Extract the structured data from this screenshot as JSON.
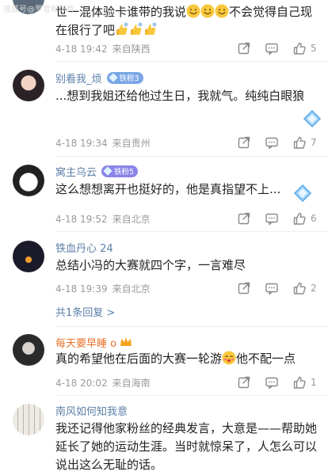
{
  "watermark": "搜狐号@罗雪和体育",
  "comments": [
    {
      "text_pre": "世一混体验卡谁带的我说",
      "text_post": "不会觉得自己现在很行了吧",
      "date": "4-18 19:42",
      "location": "来自陕西",
      "likes": "5"
    },
    {
      "username": "别看我_烦",
      "badge": "铁粉3",
      "text": "...想到我姐还给他过生日，我就气。纯纯白眼狼",
      "date": "4-18 19:34",
      "location": "来自贵州",
      "likes": "7"
    },
    {
      "username": "窝主乌云",
      "badge": "铁粉5",
      "text": "这么想想离开也挺好的，他是真指望不上...",
      "date": "4-18 19:52",
      "location": "来自北京",
      "likes": "6"
    },
    {
      "username": "铁血丹心 24",
      "text": "总结小冯的大赛就四个字，一言难尽",
      "date": "4-18 19:39",
      "location": "来自北京",
      "likes": "2",
      "replies": "共1条回复 >"
    },
    {
      "username": "每天要早睡 o",
      "text_pre": "真的希望他在后面的大赛一轮游",
      "text_post": "他不配一点",
      "date": "4-18 20:02",
      "location": "来自海南",
      "likes": "1"
    },
    {
      "username": "南风如何知我意",
      "text": "我还记得他家粉丝的经典发言，大意是——帮助她延长了她的运动生涯。当时就惊呆了，人怎么可以说出这么无耻的话。"
    }
  ],
  "icons": [
    "share-icon",
    "comment-icon",
    "like-icon",
    "smile-emoji",
    "thumbs-emoji",
    "blush-emoji",
    "diamond-sticker"
  ],
  "colors": {
    "username": "#5b7fa8",
    "username_highlight": "#e8722c",
    "badge_blue": "#7aa6e6",
    "badge_purple": "#8a84e8",
    "meta": "#9a9a9a"
  }
}
